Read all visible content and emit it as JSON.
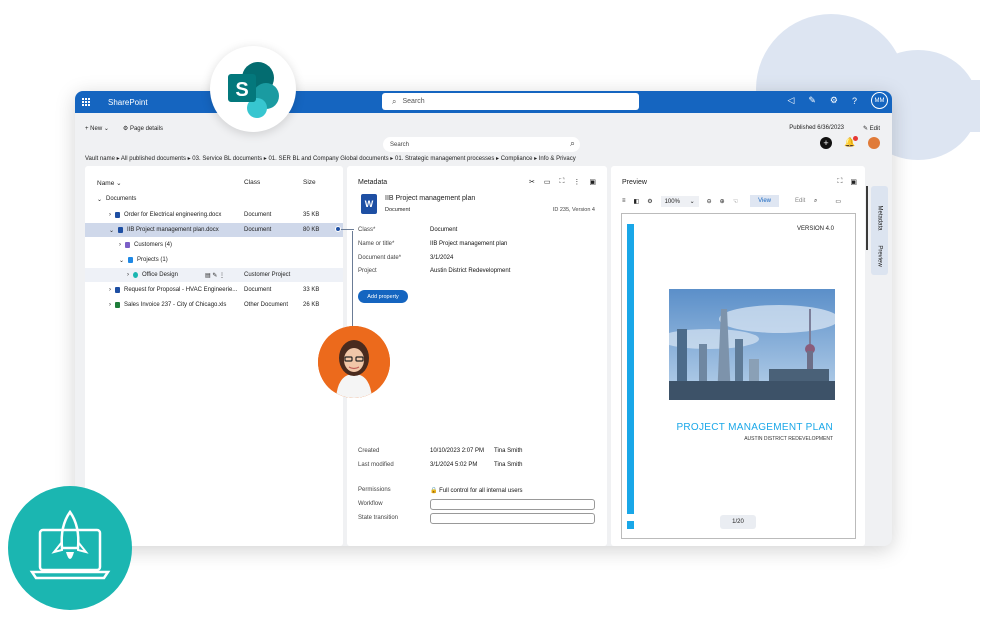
{
  "topbar": {
    "app_name": "SharePoint",
    "search_placeholder": "Search",
    "user_initials": "MM"
  },
  "commandbar": {
    "new_label": "New",
    "page_details_label": "Page details",
    "published_label": "Published 6/36/2023",
    "edit_label": "Edit"
  },
  "search2": {
    "placeholder": "Search"
  },
  "breadcrumb": "Vault name ▸ All published documents ▸ 03. Service BL documents ▸ 01. SER BL and Company Global documents ▸ 01. Strategic management processes ▸ Compliance ▸ Info & Privacy",
  "list": {
    "headers": {
      "name": "Name",
      "class": "Class",
      "size": "Size"
    },
    "root": "Documents",
    "rows": [
      {
        "name": "Order for Electrical engineering.docx",
        "class": "Document",
        "size": "35 KB"
      },
      {
        "name": "IIB Project management plan.docx",
        "class": "Document",
        "size": "80 KB"
      },
      {
        "name": "Customers (4)",
        "class": "",
        "size": ""
      },
      {
        "name": "Projects (1)",
        "class": "",
        "size": ""
      },
      {
        "name": "Office Design",
        "class": "Customer Project",
        "size": ""
      },
      {
        "name": "Request for Proposal - HVAC Engineerie...",
        "class": "Document",
        "size": "33 KB"
      },
      {
        "name": "Sales Invoice 237 - City of Chicago.xls",
        "class": "Other Document",
        "size": "26 KB"
      }
    ]
  },
  "metadata": {
    "title": "Metadata",
    "doc_title": "IIB Project management plan",
    "doc_class": "Document",
    "doc_id": "ID 235, Version 4",
    "word_icon_letter": "W",
    "props": [
      {
        "label": "Class*",
        "value": "Document"
      },
      {
        "label": "Name or title*",
        "value": "IIB Project management plan"
      },
      {
        "label": "Document date*",
        "value": "3/1/2024"
      },
      {
        "label": "Project",
        "value": "Austin District Redevelopment"
      }
    ],
    "add_property": "Add property",
    "created_label": "Created",
    "created_value": "10/10/2023 2:07 PM",
    "created_by": "Tina Smith",
    "modified_label": "Last modified",
    "modified_value": "3/1/2024 5:02 PM",
    "modified_by": "Tina Smith",
    "permissions_label": "Permissions",
    "permissions_value": "Full control for all internal users",
    "workflow_label": "Workflow",
    "state_transition_label": "State transition"
  },
  "preview": {
    "title": "Preview",
    "zoom": "100%",
    "view_label": "View",
    "edit_label": "Edit",
    "version": "VERSION 4.0",
    "doc_heading": "PROJECT MANAGEMENT PLAN",
    "doc_sub": "AUSTIN DISTRICT REDEVELOPMENT",
    "page": "1/20"
  },
  "side_tabs": [
    "Metadata",
    "Preview"
  ],
  "colors": {
    "brand_blue": "#1565c0",
    "accent_cyan": "#19a7e8",
    "teal": "#1bb6b1",
    "orange": "#ec6a1c"
  }
}
